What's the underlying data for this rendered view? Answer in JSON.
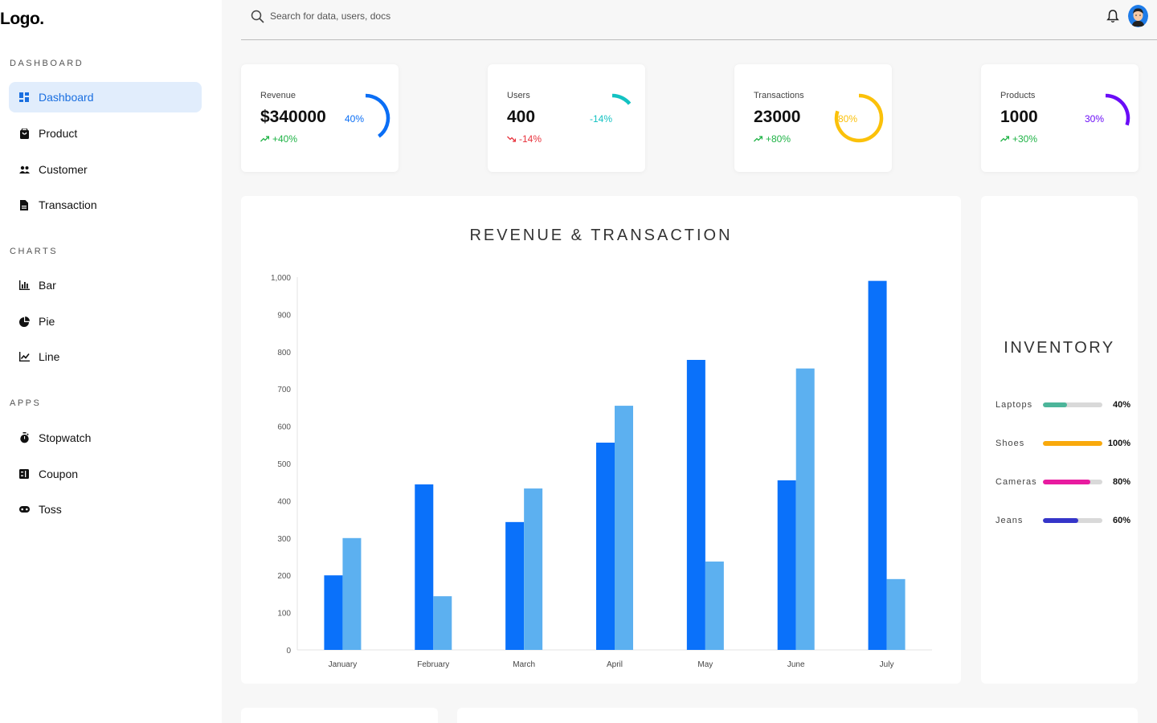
{
  "logo": "Logo.",
  "sidebar": {
    "sections": [
      {
        "title": "DASHBOARD",
        "items": [
          {
            "label": "Dashboard",
            "icon": "dashboard-icon",
            "active": true
          },
          {
            "label": "Product",
            "icon": "shopping-bag-icon"
          },
          {
            "label": "Customer",
            "icon": "people-icon"
          },
          {
            "label": "Transaction",
            "icon": "document-icon"
          }
        ]
      },
      {
        "title": "CHARTS",
        "items": [
          {
            "label": "Bar",
            "icon": "bar-chart-icon"
          },
          {
            "label": "Pie",
            "icon": "pie-chart-icon"
          },
          {
            "label": "Line",
            "icon": "line-chart-icon"
          }
        ]
      },
      {
        "title": "APPS",
        "items": [
          {
            "label": "Stopwatch",
            "icon": "stopwatch-icon"
          },
          {
            "label": "Coupon",
            "icon": "coupon-icon"
          },
          {
            "label": "Toss",
            "icon": "gamepad-icon"
          }
        ]
      }
    ]
  },
  "search": {
    "placeholder": "Search for data, users, docs"
  },
  "widgets": [
    {
      "title": "Revenue",
      "value": "$340000",
      "change": "+40%",
      "direction": "up",
      "ring_label": "40%",
      "percent": 40,
      "color": "#0a6ef5"
    },
    {
      "title": "Users",
      "value": "400",
      "change": "-14%",
      "direction": "down",
      "ring_label": "-14%",
      "percent": 14,
      "color": "#13c2c2"
    },
    {
      "title": "Transactions",
      "value": "23000",
      "change": "+80%",
      "direction": "up",
      "ring_label": "80%",
      "percent": 80,
      "color": "#fbc10a"
    },
    {
      "title": "Products",
      "value": "1000",
      "change": "+30%",
      "direction": "up",
      "ring_label": "30%",
      "percent": 30,
      "color": "#6a0cf7"
    }
  ],
  "chart_data": {
    "type": "bar",
    "title": "REVENUE & TRANSACTION",
    "categories": [
      "January",
      "February",
      "March",
      "April",
      "May",
      "June",
      "July"
    ],
    "series": [
      {
        "values": [
          200,
          444,
          343,
          556,
          778,
          455,
          990
        ],
        "color": "#0a71fa"
      },
      {
        "values": [
          300,
          144,
          433,
          655,
          237,
          755,
          190
        ],
        "color": "#5cb0f0"
      }
    ],
    "ylim": [
      0,
      1000
    ],
    "yticks": [
      "0",
      "100",
      "200",
      "300",
      "400",
      "500",
      "600",
      "700",
      "800",
      "900",
      "1,000"
    ],
    "legend": false
  },
  "inventory": {
    "title": "INVENTORY",
    "items": [
      {
        "label": "Laptops",
        "value": 40,
        "pct_label": "40%",
        "color": "#4cb59a"
      },
      {
        "label": "Shoes",
        "value": 100,
        "pct_label": "100%",
        "color": "#f9a90c"
      },
      {
        "label": "Cameras",
        "value": 80,
        "pct_label": "80%",
        "color": "#e81ba0"
      },
      {
        "label": "Jeans",
        "value": 60,
        "pct_label": "60%",
        "color": "#3535c9"
      }
    ]
  }
}
